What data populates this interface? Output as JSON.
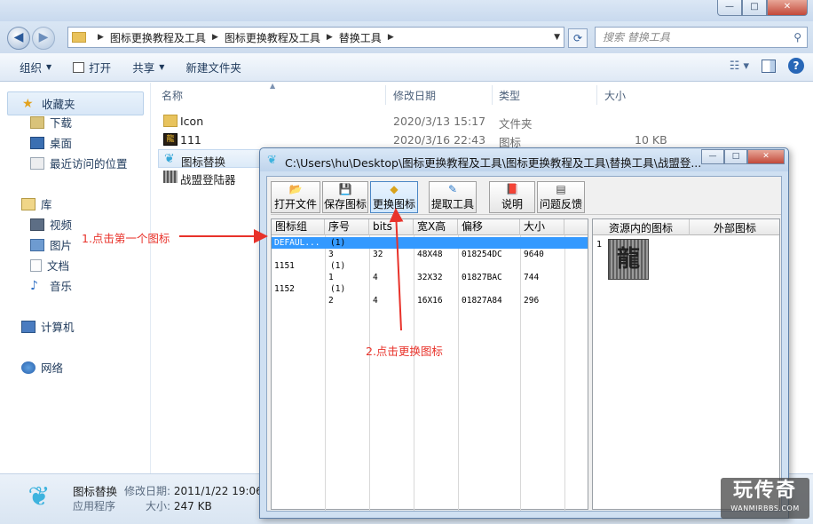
{
  "window": {
    "minimize_label": "—",
    "maximize_label": "□",
    "close_label": "✕"
  },
  "address": {
    "back_label": "◀",
    "forward_label": "▶",
    "crumbs": [
      "图标更换教程及工具",
      "图标更换教程及工具",
      "替换工具"
    ],
    "search_placeholder": "搜索 替换工具"
  },
  "toolbar": {
    "organize": "组织",
    "open": "打开",
    "share": "共享",
    "new_folder": "新建文件夹"
  },
  "sidebar": {
    "favorites": "收藏夹",
    "downloads": "下载",
    "desktop": "桌面",
    "recent": "最近访问的位置",
    "libraries": "库",
    "videos": "视频",
    "pictures": "图片",
    "documents": "文档",
    "music": "音乐",
    "computer": "计算机",
    "network": "网络"
  },
  "list": {
    "headers": {
      "name": "名称",
      "modified": "修改日期",
      "type": "类型",
      "size": "大小"
    },
    "files": [
      {
        "name": "Icon",
        "modified": "2020/3/13 15:17",
        "type": "文件夹",
        "size": ""
      },
      {
        "name": "111",
        "modified": "2020/3/16 22:43",
        "type": "图标",
        "size": "10 KB"
      },
      {
        "name": "图标替换",
        "modified": "",
        "type": "",
        "size": ""
      },
      {
        "name": "战盟登陆器",
        "modified": "",
        "type": "",
        "size": ""
      }
    ]
  },
  "details": {
    "name": "图标替换",
    "type": "应用程序",
    "modified_label": "修改日期:",
    "modified_value": "2011/1/22 19:06",
    "size_label": "大小:",
    "size_value": "247 KB"
  },
  "dialog": {
    "title": "C:\\Users\\hu\\Desktop\\图标更换教程及工具\\图标更换教程及工具\\替换工具\\战盟登...",
    "buttons": {
      "open": "打开文件",
      "save": "保存图标",
      "replace": "更换图标",
      "extract": "提取工具",
      "readme": "说明",
      "feedback": "问题反馈"
    },
    "grid_headers": [
      "图标组",
      "序号",
      "bits",
      "宽X高",
      "偏移",
      "大小"
    ],
    "rows": [
      [
        "DEFAUL...",
        "(1)",
        "",
        "",
        "",
        ""
      ],
      [
        "",
        "3",
        "32",
        "48X48",
        "018254DC",
        "9640"
      ],
      [
        "1151",
        "(1)",
        "",
        "",
        "",
        ""
      ],
      [
        "",
        "1",
        "4",
        "32X32",
        "01827BAC",
        "744"
      ],
      [
        "1152",
        "(1)",
        "",
        "",
        "",
        ""
      ],
      [
        "",
        "2",
        "4",
        "16X16",
        "01827A84",
        "296"
      ]
    ],
    "right_headers": {
      "resource": "资源内的图标",
      "external": "外部图标"
    },
    "preview_index": "1",
    "preview_glyph": "龍"
  },
  "annotations": {
    "step1": "1.点击第一个图标",
    "step2": "2.点击更换图标"
  },
  "watermark": {
    "main": "玩传奇",
    "sub": "WANMIRBBS.COM"
  },
  "colors": {
    "annotation": "#e8322a",
    "selection": "#3399ff"
  }
}
